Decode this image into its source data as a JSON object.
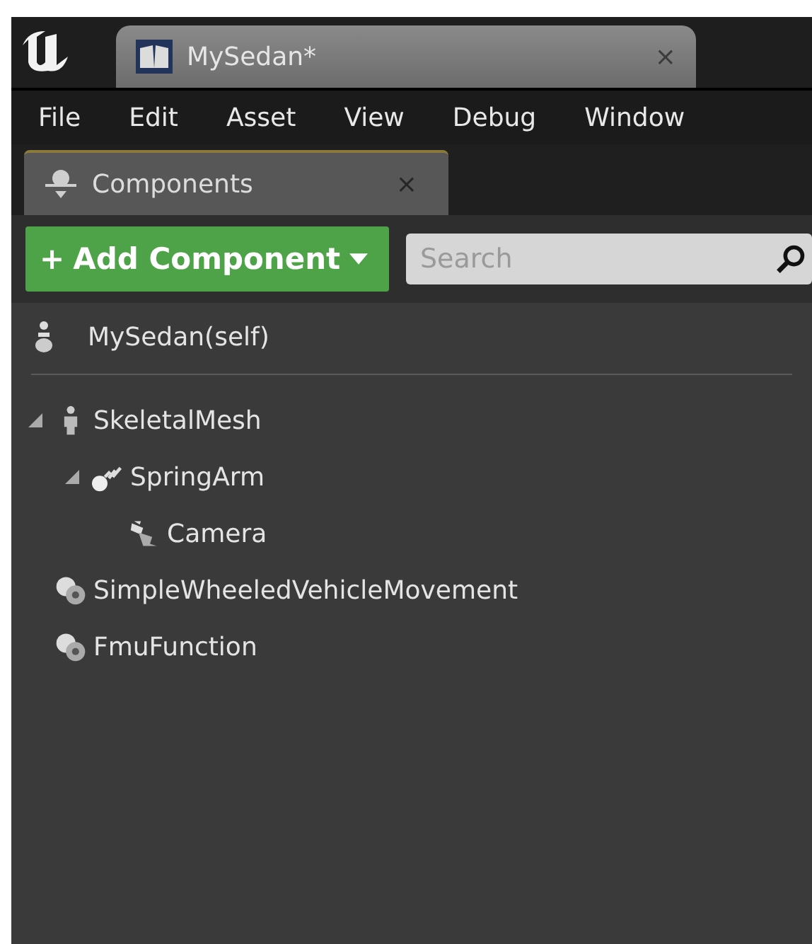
{
  "document_tab": {
    "title": "MySedan*",
    "close": "×",
    "selected": true
  },
  "menu": [
    "File",
    "Edit",
    "Asset",
    "View",
    "Debug",
    "Window"
  ],
  "panel_tab": {
    "title": "Components",
    "close": "×",
    "selected": true
  },
  "toolbar": {
    "add_button": {
      "plus": "+",
      "label": "Add Component"
    },
    "search": {
      "placeholder": "Search"
    }
  },
  "root": {
    "label": "MySedan(self)"
  },
  "tree": [
    {
      "label": "SkeletalMesh",
      "kind": "figure",
      "expanded": true,
      "children": [
        {
          "label": "SpringArm",
          "kind": "spring",
          "expanded": true,
          "children": [
            {
              "label": "Camera",
              "kind": "camera"
            }
          ]
        }
      ]
    },
    {
      "label": "SimpleWheeledVehicleMovement",
      "kind": "gears"
    },
    {
      "label": "FmuFunction",
      "kind": "gears"
    }
  ]
}
